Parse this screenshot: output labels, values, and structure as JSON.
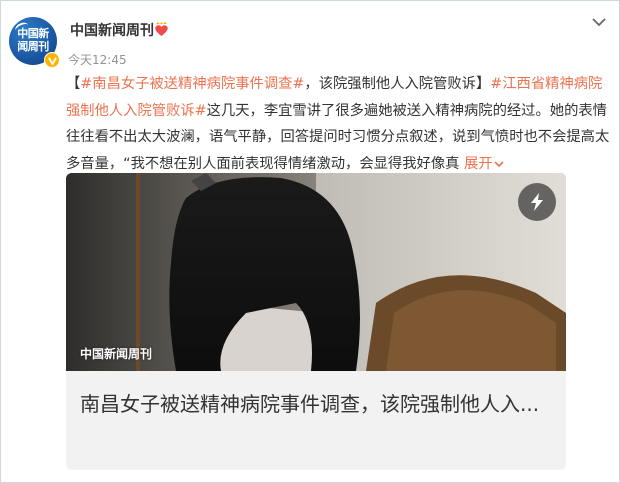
{
  "post": {
    "author": "中国新闻周刊",
    "avatar_text": "中国新闻周刊",
    "time": "今天12:45",
    "tag1": "#南昌女子被送精神病院事件调查#",
    "title_text": "，该院强制他人入院管败诉】",
    "tag2": "#江西省精神病院强制他人入院管败诉#",
    "body": "这几天，李宜雪讲了很多遍她被送入精神病院的经过。她的表情往往看不出太大波澜，语气平静，回答提问时习惯分点叙述，说到气愤时也不会提高太多音量，“我不想在别人面前表现得情绪激动，会显得我好像真",
    "expand_label": "展开"
  },
  "media": {
    "watermark": "中国新闻周刊",
    "card_title": "南昌女子被送精神病院事件调查，该院强制他人入..."
  },
  "colors": {
    "link": "#eb7350",
    "verified_badge": "#ffb400",
    "card_bg": "#f2f2f2"
  },
  "icons": {
    "verified": "verified-v-icon",
    "heart_badge": "heart-crown-icon",
    "menu": "chevron-down-icon",
    "play": "lightning-icon"
  }
}
